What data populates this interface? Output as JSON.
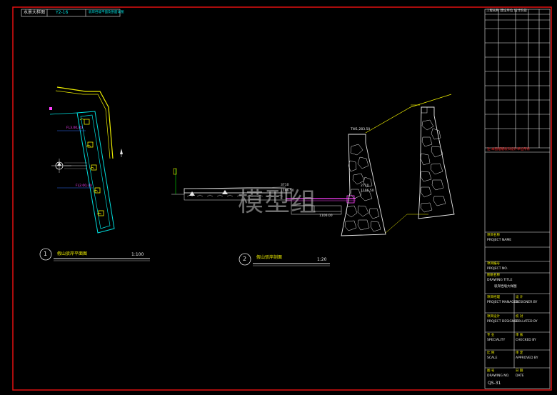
{
  "header": {
    "label": "水景大样图",
    "code": "Y2-16",
    "title": "驳岸挡墙平面及剖面详图"
  },
  "views": {
    "plan": {
      "number": "1",
      "title": "假山驳岸平面图",
      "scale": "1:100"
    },
    "section": {
      "number": "2",
      "title": "假山驳岸剖面",
      "scale": "1:20"
    }
  },
  "plan_annotations": {
    "elev_top": "FL3.00,(4)",
    "elev_bottom": "FL2.00,(4)"
  },
  "section_annotations": {
    "top": "TW1,283.50",
    "mid1": "2710",
    "mid2": "1106.50",
    "low": "1106.00",
    "left": "3710",
    "left2": "1106.50"
  },
  "title_block": {
    "header_row": "工程名称 建设单位 设计阶段",
    "red_note": "注:本图纸版权归设计单位所有",
    "project_name_cn": "项目名称",
    "project_name_en": "PROJECT NAME",
    "project_no_cn": "项目编号",
    "project_no_en": "PROJECT NO.",
    "drawing_title_cn": "图纸名称",
    "drawing_title_en": "DRAWING TITLE",
    "drawing_title_value": "驳岸挡墙大样图",
    "pm_cn": "项目经理",
    "pm_en": "PROJECT MANAGER",
    "designer_cn": "设 计",
    "designer_en": "DESIGNER BY",
    "pd_cn": "项目设计",
    "pd_en": "PROJECT DESIGNER",
    "collated_cn": "校 对",
    "collated_en": "COLLATED BY",
    "specialty_cn": "专 业",
    "specialty_en": "SPECIALITY",
    "checked_cn": "审 核",
    "checked_en": "CHECKED BY",
    "scale_cn": "比 例",
    "scale_en": "SCALE",
    "approved_cn": "审 定",
    "approved_en": "APPROVED BY",
    "drawing_no_cn": "图 号",
    "drawing_no_en": "DRAWING NO.",
    "date_cn": "日 期",
    "date_en": "DATE",
    "drawing_no_value": "QS-31"
  },
  "watermark": "模型组",
  "colors": {
    "frame": "#e01010",
    "yellow": "#f0f000",
    "cyan": "#00e0e0",
    "white": "#e8e8e8",
    "magenta": "#ff40ff"
  }
}
